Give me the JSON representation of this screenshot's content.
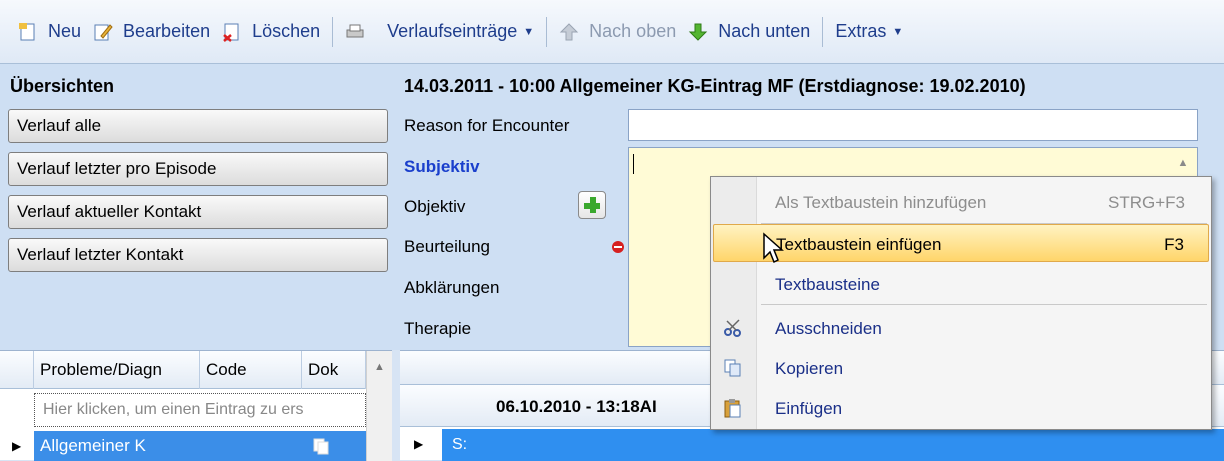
{
  "toolbar": {
    "new_label": "Neu",
    "edit_label": "Bearbeiten",
    "delete_label": "Löschen",
    "history_label": "Verlaufseinträge",
    "up_label": "Nach oben",
    "down_label": "Nach unten",
    "extras_label": "Extras"
  },
  "overview": {
    "title": "Übersichten",
    "buttons": [
      "Verlauf alle",
      "Verlauf letzter pro Episode",
      "Verlauf aktueller Kontakt",
      "Verlauf letzter Kontakt"
    ]
  },
  "entry": {
    "title": "14.03.2011 - 10:00 Allgemeiner KG-Eintrag MF (Erstdiagnose: 19.02.2010)",
    "fields": [
      "Reason for Encounter",
      "Subjektiv",
      "Objektiv",
      "Beurteilung",
      "Abklärungen",
      "Therapie"
    ],
    "reason_value": "",
    "subjektiv_value": ""
  },
  "problems_grid": {
    "headers": [
      "Probleme/Diagn",
      "Code",
      "Dok"
    ],
    "new_row_placeholder": "Hier klicken, um einen Eintrag zu ers",
    "rows": [
      {
        "name": "Allgemeiner K"
      }
    ]
  },
  "history_grid": {
    "date_header": "06.10.2010 - 13:18AI",
    "row_label": "S:"
  },
  "context_menu": {
    "items": [
      {
        "label": "Als Textbaustein hinzufügen",
        "shortcut": "STRG+F3"
      },
      {
        "label": "Textbaustein einfügen",
        "shortcut": "F3"
      },
      {
        "label": "Textbausteine",
        "shortcut": ""
      },
      {
        "label": "Ausschneiden",
        "shortcut": ""
      },
      {
        "label": "Kopieren",
        "shortcut": ""
      },
      {
        "label": "Einfügen",
        "shortcut": ""
      }
    ]
  },
  "colors": {
    "selection_blue": "#3b8ee8",
    "subjektiv_bg": "#fffbd6",
    "menu_hover": "#ffd56a",
    "panel_bg": "#cedff3"
  }
}
